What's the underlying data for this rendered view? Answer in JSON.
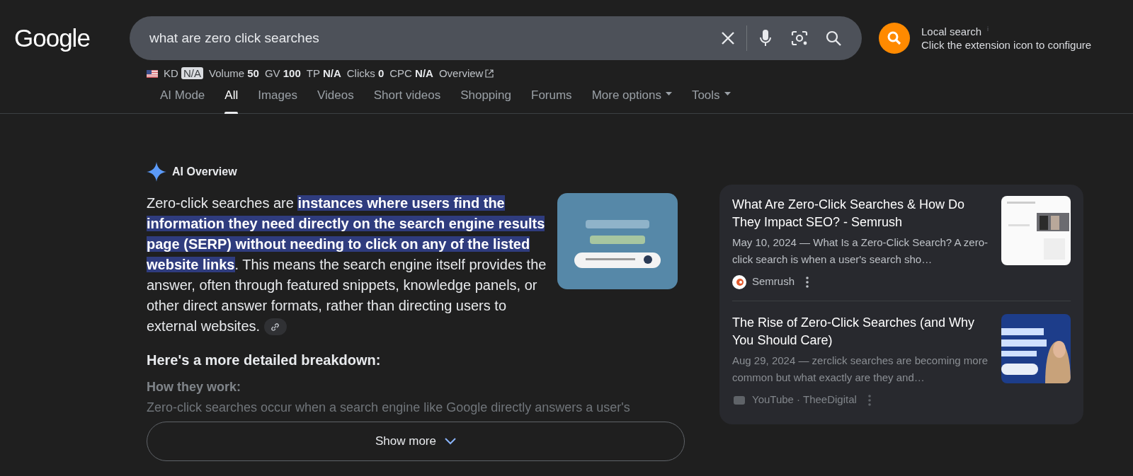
{
  "logo": "Google",
  "search": {
    "value": "what are zero click searches"
  },
  "extension": {
    "title": "Local search",
    "info": "i",
    "subtitle": "Click the extension icon to configure"
  },
  "metrics": [
    {
      "kind": "plain",
      "label": "KD",
      "value": "N/A",
      "badge": true
    },
    {
      "kind": "plain",
      "label": "Volume",
      "value": "50",
      "badge": false
    },
    {
      "kind": "plain",
      "label": "GV",
      "value": "100",
      "badge": false
    },
    {
      "kind": "plain",
      "label": "TP",
      "value": "N/A",
      "badge": false
    },
    {
      "kind": "plain",
      "label": "Clicks",
      "value": "0",
      "badge": false
    },
    {
      "kind": "plain",
      "label": "CPC",
      "value": "N/A",
      "badge": false
    },
    {
      "kind": "link",
      "label": "Overview"
    }
  ],
  "tabs": [
    {
      "label": "AI Mode",
      "selected": false,
      "has_menu": false
    },
    {
      "label": "All",
      "selected": true,
      "has_menu": false
    },
    {
      "label": "Images",
      "selected": false,
      "has_menu": false
    },
    {
      "label": "Videos",
      "selected": false,
      "has_menu": false
    },
    {
      "label": "Short videos",
      "selected": false,
      "has_menu": false
    },
    {
      "label": "Shopping",
      "selected": false,
      "has_menu": false
    },
    {
      "label": "Forums",
      "selected": false,
      "has_menu": false
    },
    {
      "label": "More options",
      "selected": false,
      "has_menu": true
    },
    {
      "label": "Tools",
      "selected": false,
      "has_menu": true
    }
  ],
  "ai_overview": {
    "title": "AI Overview",
    "paragraph": {
      "before": "Zero-click searches are ",
      "highlight": "instances where users find the information they need directly on the search engine results page (SERP) without needing to click on any of the listed website links",
      "after": ". This means the search engine itself provides the answer, often through featured snippets, knowledge panels, or other direct answer formats, rather than directing users to external websites."
    },
    "heading": "Here's a more detailed breakdown:",
    "faded_heading": "How they work:",
    "faded_text": "Zero-click searches occur when a search engine like Google directly answers a user's",
    "show_more": "Show more"
  },
  "sources": [
    {
      "title": "What Are Zero-Click Searches & How Do They Impact SEO? - Semrush",
      "date": "May 10, 2024 —",
      "snippet": "What Is a Zero-Click Search? A zero-click search is when a user's search sho…",
      "site": "Semrush",
      "faded": false
    },
    {
      "title": "The Rise of Zero-Click Searches (and Why You Should Care)",
      "date": "Aug 29, 2024 —",
      "snippet": "zerclick searches are becoming more common but what exactly are they and…",
      "site": "YouTube · TheeDigital",
      "faded": true
    }
  ]
}
